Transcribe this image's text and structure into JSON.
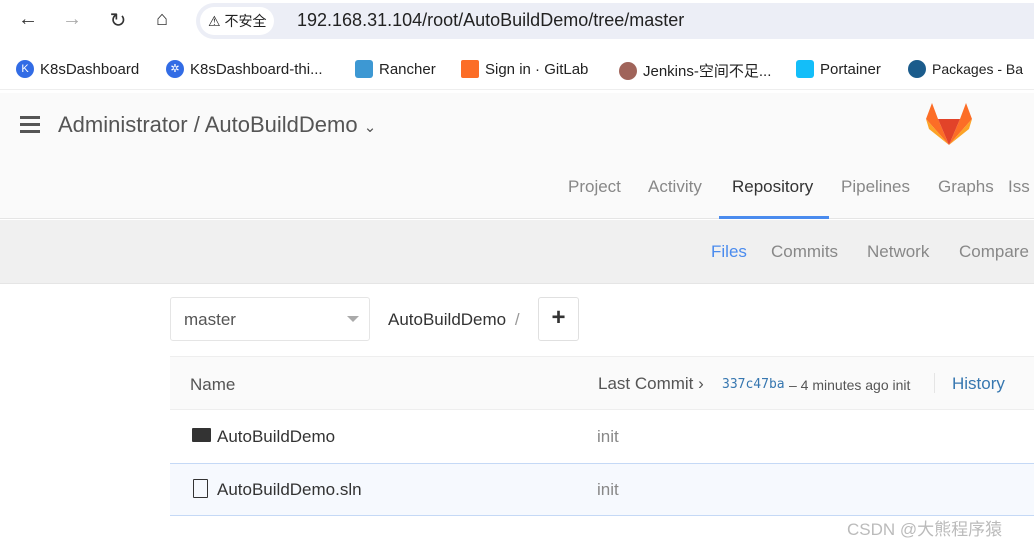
{
  "browser": {
    "security_label": "不安全",
    "url": "192.168.31.104/root/AutoBuildDemo/tree/master",
    "bookmarks": [
      {
        "label": "K8sDashboard",
        "color": "#326ce5"
      },
      {
        "label": "K8sDashboard-thi...",
        "color": "#326ce5"
      },
      {
        "label": "Rancher",
        "color": "#3d98d3"
      },
      {
        "label": "Sign in · GitLab",
        "color": "#fc6d26"
      },
      {
        "label": "Jenkins-空间不足...",
        "color": "#a0645a"
      },
      {
        "label": "Portainer",
        "color": "#13bef9"
      },
      {
        "label": "Packages - Ba",
        "color": "#1b5c8c"
      }
    ]
  },
  "header": {
    "title": "Administrator / AutoBuildDemo",
    "logo": "gitlab-tanuki",
    "tabs": [
      "Project",
      "Activity",
      "Repository",
      "Pipelines",
      "Graphs",
      "Iss"
    ],
    "active_tab": "Repository"
  },
  "subnav": {
    "items": [
      "Files",
      "Commits",
      "Network",
      "Compare"
    ],
    "active": "Files"
  },
  "toolbar": {
    "branch": "master",
    "path": "AutoBuildDemo",
    "path_sep": "/",
    "add_label": "+"
  },
  "table": {
    "name_header": "Name",
    "last_commit_label": "Last Commit",
    "commit_sha": "337c47ba",
    "commit_meta": "– 4 minutes ago init",
    "history_label": "History",
    "rows": [
      {
        "icon": "folder-icon",
        "name": "AutoBuildDemo",
        "commit": "init"
      },
      {
        "icon": "file-icon",
        "name": "AutoBuildDemo.sln",
        "commit": "init"
      }
    ]
  },
  "watermark": "CSDN @大熊程序猿",
  "colors": {
    "accent": "#4a8bee",
    "link": "#3777b0"
  }
}
